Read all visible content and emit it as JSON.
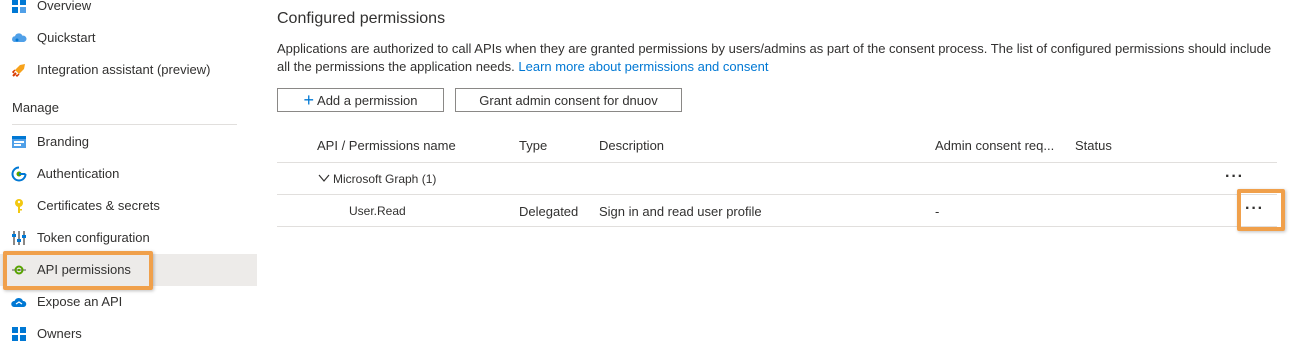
{
  "sidebar": {
    "items": [
      {
        "label": "Overview",
        "icon": "grid-icon"
      },
      {
        "label": "Quickstart",
        "icon": "cloud-icon"
      },
      {
        "label": "Integration assistant (preview)",
        "icon": "rocket-icon"
      },
      {
        "label": "Branding",
        "icon": "branding-icon"
      },
      {
        "label": "Authentication",
        "icon": "authentication-icon"
      },
      {
        "label": "Certificates & secrets",
        "icon": "key-icon"
      },
      {
        "label": "Token configuration",
        "icon": "token-config-icon"
      },
      {
        "label": "API permissions",
        "icon": "api-permissions-icon"
      },
      {
        "label": "Expose an API",
        "icon": "cloud-api-icon"
      },
      {
        "label": "Owners",
        "icon": "owners-icon"
      }
    ],
    "section_header": "Manage",
    "selected": "API permissions"
  },
  "main": {
    "title": "Configured permissions",
    "description": "Applications are authorized to call APIs when they are granted permissions by users/admins as part of the consent process. The list of configured permissions should include all the permissions the application needs.",
    "learn_more_link": "Learn more about permissions and consent",
    "buttons": {
      "add_permission": "Add a permission",
      "grant_consent": "Grant admin consent for dnuov"
    },
    "table": {
      "columns": [
        "API / Permissions name",
        "Type",
        "Description",
        "Admin consent req...",
        "Status"
      ],
      "group": {
        "name": "Microsoft Graph (1)"
      },
      "rows": [
        {
          "name": "User.Read",
          "type": "Delegated",
          "description": "Sign in and read user profile",
          "admin_consent": "-",
          "status": ""
        }
      ],
      "more_glyph": "···"
    }
  },
  "colors": {
    "accent": "#0078d4",
    "highlight": "#f0a04b",
    "selected_bg": "#edebe9"
  }
}
